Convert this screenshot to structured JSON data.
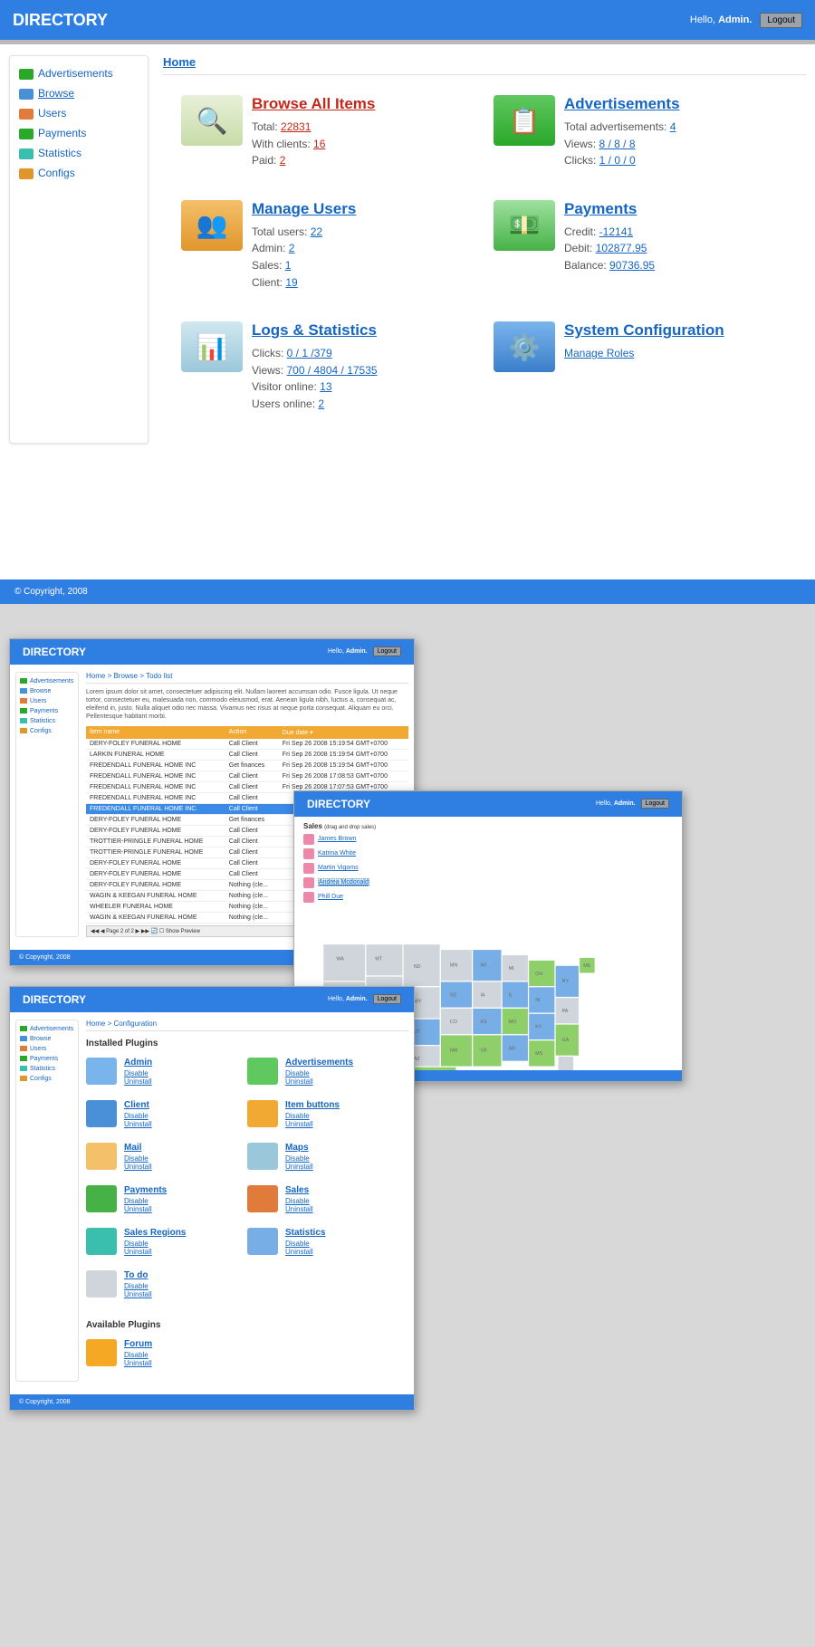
{
  "app": {
    "title": "DIRECTORY",
    "greeting_prefix": "Hello, ",
    "user": "Admin.",
    "logout": "Logout"
  },
  "sidebar": {
    "items": [
      {
        "label": "Advertisements",
        "color": "#2aa82a"
      },
      {
        "label": "Browse",
        "color": "#4a90d9"
      },
      {
        "label": "Users",
        "color": "#e07b3c"
      },
      {
        "label": "Payments",
        "color": "#2aa82a"
      },
      {
        "label": "Statistics",
        "color": "#3abead"
      },
      {
        "label": "Configs",
        "color": "#e0962c"
      }
    ]
  },
  "crumb": {
    "home": "Home"
  },
  "dashboard": {
    "browse": {
      "title": "Browse All Items",
      "total_l": "Total: ",
      "total": "22831",
      "wc_l": "With clients: ",
      "wc": "16",
      "paid_l": "Paid: ",
      "paid": "2"
    },
    "ads": {
      "title": "Advertisements",
      "ta_l": "Total advertisements: ",
      "ta": "4",
      "vw_l": "Views: ",
      "vw": "8 / 8 / 8",
      "ck_l": "Clicks: ",
      "ck": "1 / 0 / 0"
    },
    "users": {
      "title": "Manage Users",
      "tu_l": "Total users: ",
      "tu": "22",
      "ad_l": "Admin: ",
      "ad": "2",
      "sa_l": "Sales: ",
      "sa": "1",
      "cl_l": "Client: ",
      "cl": "19"
    },
    "pay": {
      "title": "Payments",
      "cr_l": "Credit: ",
      "cr": "-12141",
      "de_l": "Debit: ",
      "de": "102877.95",
      "ba_l": "Balance: ",
      "ba": "90736.95"
    },
    "logs": {
      "title": "Logs & Statistics",
      "ck_l": "Clicks: ",
      "ck": "0 / 1 /379",
      "vw_l": "Views: ",
      "vw": "700 / 4804 / 17535",
      "vo_l": "Visitor online: ",
      "vo": "13",
      "uo_l": "Users online: ",
      "uo": "2"
    },
    "sys": {
      "title": "System Configuration",
      "roles": "Manage Roles"
    }
  },
  "footer": {
    "copy": "© Copyright, 2008"
  },
  "pv_todo": {
    "crumb": "Home > Browse > Todo list",
    "lorem": "Lorem ipsum dolor sit amet, consectetuer adipiscing elit. Nullam laoreet accumsan odio. Fusce ligula. Ut neque tortor, consectetuer eu, malesuada non, commodo eleiusmod, erat. Aenean ligula nibh, luctus a, consequat ac, eleifend in, justo. Nulla aliquet odio nec massa. Vivamus nec risus at neque porta consequat. Aliquam eu orci. Pellentesque habitant morbi.",
    "title": "Todo list",
    "cols": [
      "Item name",
      "Action",
      "Due date ▾"
    ],
    "rows": [
      [
        "DERY-FOLEY FUNERAL HOME",
        "Call Client",
        "Fri Sep 26 2008 15:19:54 GMT+0700"
      ],
      [
        "LARKIN FUNERAL HOME",
        "Call Client",
        "Fri Sep 26 2008 15:19:54 GMT+0700"
      ],
      [
        "FREDENDALL FUNERAL HOME INC",
        "Get finances",
        "Fri Sep 26 2008 15:19:54 GMT+0700"
      ],
      [
        "FREDENDALL FUNERAL HOME INC",
        "Call Client",
        "Fri Sep 26 2008 17:08:53 GMT+0700"
      ],
      [
        "FREDENDALL FUNERAL HOME INC",
        "Call Client",
        "Fri Sep 26 2008 17:07:53 GMT+0700"
      ],
      [
        "FREDENDALL FUNERAL HOME INC",
        "Call Client",
        ""
      ],
      [
        "FREDENDALL FUNERAL HOME INC.",
        "Call Client",
        ""
      ],
      [
        "DERY-FOLEY FUNERAL HOME",
        "Get finances",
        ""
      ],
      [
        "DERY-FOLEY FUNERAL HOME",
        "Call Client",
        ""
      ],
      [
        "TROTTIER-PRINGLE FUNERAL HOME",
        "Call Client",
        ""
      ],
      [
        "TROTTIER-PRINGLE FUNERAL HOME",
        "Call Client",
        ""
      ],
      [
        "DERY-FOLEY FUNERAL HOME",
        "Call Client",
        ""
      ],
      [
        "DERY-FOLEY FUNERAL HOME",
        "Call Client",
        ""
      ],
      [
        "DERY-FOLEY FUNERAL HOME",
        "Nothing (cle...",
        ""
      ],
      [
        "WAGIN & KEEGAN FUNERAL HOME",
        "Nothing (cle...",
        ""
      ],
      [
        "WHEELER FUNERAL HOME",
        "Nothing (cle...",
        ""
      ],
      [
        "WAGIN & KEEGAN FUNERAL HOME",
        "Nothing (cle...",
        ""
      ]
    ],
    "pager": "◀◀ ◀  Page 2 of 2  ▶ ▶▶ 🔄  ☐ Show Preview"
  },
  "pv_map": {
    "sales_title": "Sales",
    "hint": "(drag and drop sales)",
    "people": [
      "James Brown",
      "Katrina White",
      "Martin Vigoms",
      "Andrea Mcdonald",
      "Phill Due"
    ]
  },
  "pv_cfg": {
    "crumb": "Home > Configuration",
    "h_installed": "Installed Plugins",
    "h_available": "Available Plugins",
    "dis": "Disable",
    "uni": "Uninstall",
    "installed": [
      "Admin",
      "Advertisements",
      "Client",
      "Item buttons",
      "Mail",
      "Maps",
      "Payments",
      "Sales",
      "Sales Regions",
      "Statistics",
      "To do"
    ],
    "available": [
      "Forum"
    ]
  }
}
